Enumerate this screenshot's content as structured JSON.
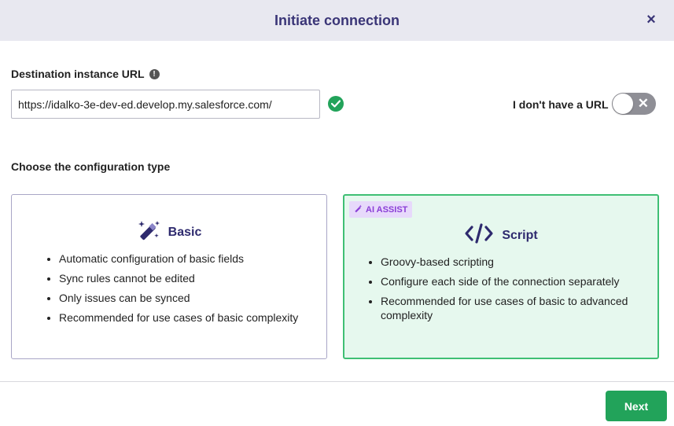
{
  "dialog": {
    "title": "Initiate connection",
    "close_icon": "close-icon"
  },
  "destination": {
    "label": "Destination instance URL",
    "info_icon": "exclamation-icon",
    "url_value": "https://idalko-3e-dev-ed.develop.my.salesforce.com/",
    "validated": true,
    "no_url_label": "I don't have a URL",
    "no_url_toggle": false
  },
  "config": {
    "title": "Choose the configuration type",
    "options": [
      {
        "name": "Basic",
        "icon": "magic-wand-icon",
        "selected": false,
        "bullets": [
          "Automatic configuration of basic fields",
          "Sync rules cannot be edited",
          "Only issues can be synced",
          "Recommended for use cases of basic complexity"
        ]
      },
      {
        "name": "Script",
        "icon": "code-icon",
        "badge": "AI ASSIST",
        "selected": true,
        "bullets": [
          "Groovy-based scripting",
          "Configure each side of the connection separately",
          "Recommended for use cases of basic to advanced complexity"
        ]
      }
    ]
  },
  "footer": {
    "next_label": "Next"
  },
  "colors": {
    "header_bg": "#e8e8f0",
    "brand": "#3a3577",
    "accent_green": "#22a35a",
    "selected_card_bg": "#e6f8ee",
    "badge_bg": "#e7d9fb",
    "badge_text": "#8a3ed6"
  }
}
